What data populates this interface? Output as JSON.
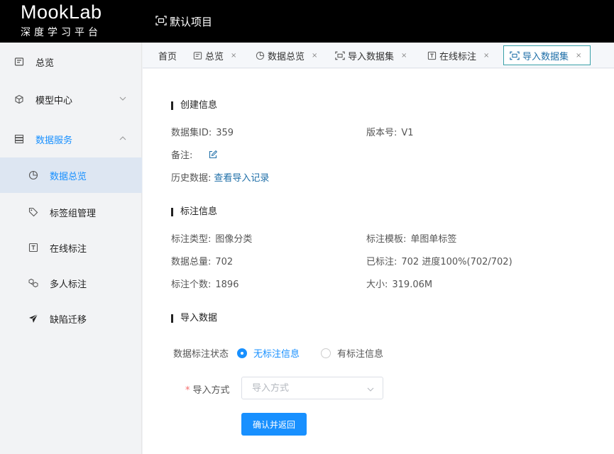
{
  "header": {
    "logo_main": "MookLab",
    "logo_sub": "深度学习平台",
    "project_icon": "scan-icon",
    "project_name": "默认项目"
  },
  "sidebar": {
    "items": [
      {
        "label": "总览",
        "icon": "overview-icon"
      },
      {
        "label": "模型中心",
        "icon": "cube-icon",
        "chevron": "down"
      },
      {
        "label": "数据服务",
        "icon": "database-icon",
        "chevron": "up",
        "active": true
      },
      {
        "label": "数据总览",
        "icon": "pie-chart-icon",
        "selected": true
      },
      {
        "label": "标签组管理",
        "icon": "tag-icon"
      },
      {
        "label": "在线标注",
        "icon": "text-box-icon"
      },
      {
        "label": "多人标注",
        "icon": "cubes-icon"
      },
      {
        "label": "缺陷迁移",
        "icon": "send-icon"
      }
    ]
  },
  "tabs": [
    {
      "label": "首页"
    },
    {
      "label": "总览",
      "close": "×"
    },
    {
      "label": "数据总览",
      "close": "×"
    },
    {
      "label": "导入数据集",
      "close": "×"
    },
    {
      "label": "在线标注",
      "close": "×"
    },
    {
      "label": "导入数据集",
      "close": "×",
      "active": true
    }
  ],
  "create_info": {
    "title": "创建信息",
    "dataset_id_label": "数据集ID:",
    "dataset_id": "359",
    "version_label": "版本号:",
    "version": "V1",
    "remark_label": "备注:",
    "history_label": "历史数据:",
    "history_link": "查看导入记录"
  },
  "annotation_info": {
    "title": "标注信息",
    "type_label": "标注类型:",
    "type": "图像分类",
    "template_label": "标注模板:",
    "template": "单图单标签",
    "total_label": "数据总量:",
    "total": "702",
    "labeled_label": "已标注:",
    "labeled": "702 进度100%(702/702)",
    "count_label": "标注个数:",
    "count": "1896",
    "size_label": "大小:",
    "size": "319.06M"
  },
  "import_data": {
    "title": "导入数据",
    "status_label": "数据标注状态",
    "options": [
      "无标注信息",
      "有标注信息"
    ],
    "selected_option": "无标注信息",
    "method_star": "*",
    "method_label": "导入方式",
    "method_placeholder": "导入方式",
    "submit_label": "确认并返回"
  },
  "colors": {
    "primary": "#1890ff",
    "link": "#1f6fa8",
    "header_bg": "#000000",
    "sidebar_bg": "#f2f3f5",
    "selected_bg": "#dde6f2"
  }
}
